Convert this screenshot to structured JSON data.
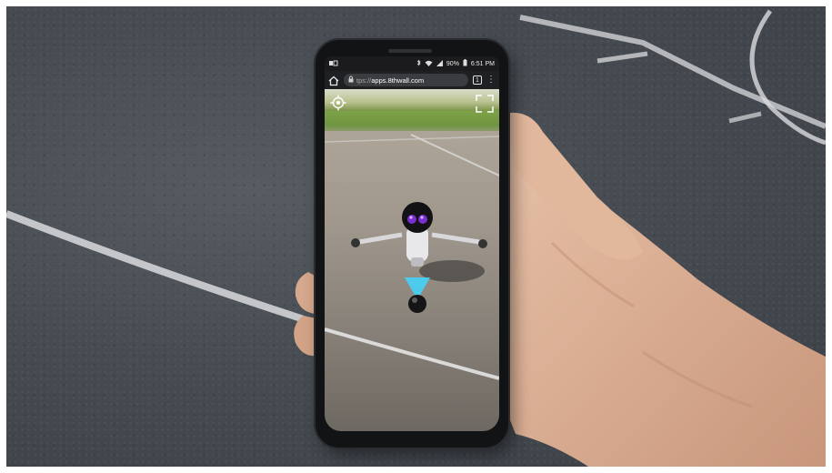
{
  "status_bar": {
    "battery": "90%",
    "time": "6:51 PM",
    "icons": [
      "notification-icon",
      "bluetooth-icon",
      "wifi-icon",
      "signal-icon",
      "battery-icon"
    ]
  },
  "browser": {
    "url_prefix": "tps://",
    "url_host": "apps.8thwall.com",
    "tab_count": "1",
    "icons": [
      "home-icon",
      "lock-icon",
      "tabs-icon",
      "menu-icon"
    ]
  },
  "ar_view": {
    "icons": [
      "recenter-icon",
      "fullscreen-icon"
    ]
  },
  "colors": {
    "robot_visor": "#7a2fd0",
    "beam": "#3fd6ff",
    "robot_body": "#e8e8ea"
  }
}
